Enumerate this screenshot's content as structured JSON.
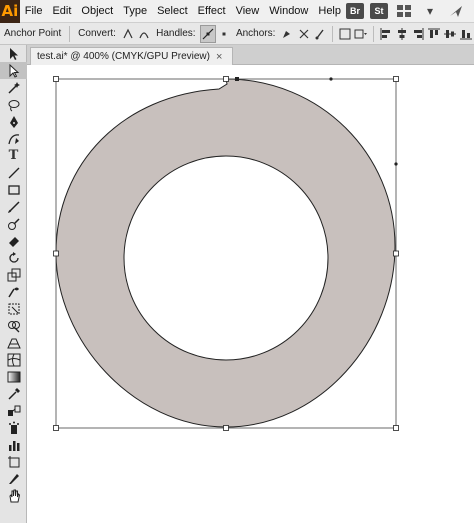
{
  "menubar": {
    "logo": "Ai",
    "items": [
      "File",
      "Edit",
      "Object",
      "Type",
      "Select",
      "Effect",
      "View",
      "Window",
      "Help"
    ],
    "right_badges": [
      "Br",
      "St"
    ]
  },
  "controlbar": {
    "anchor_point_label": "Anchor Point",
    "convert_label": "Convert:",
    "handles_label": "Handles:",
    "anchors_label": "Anchors:"
  },
  "document": {
    "tab_title": "test.ai* @ 400% (CMYK/GPU Preview)",
    "close_glyph": "×"
  },
  "artwork": {
    "ring_fill": "#c8c0bd",
    "stroke": "#222222",
    "hole_fill": "#ffffff"
  },
  "toolbar": {
    "tools": [
      "selection-tool",
      "direct-selection-tool",
      "magic-wand-tool",
      "lasso-tool",
      "pen-tool",
      "curvature-tool",
      "type-tool",
      "line-segment-tool",
      "rectangle-tool",
      "paintbrush-tool",
      "shaper-tool",
      "eraser-tool",
      "rotate-tool",
      "scale-tool",
      "warp-tool",
      "free-transform-tool",
      "shape-builder-tool",
      "perspective-grid-tool",
      "mesh-tool",
      "gradient-tool",
      "eyedropper-tool",
      "blend-tool",
      "symbol-sprayer-tool",
      "column-graph-tool",
      "artboard-tool",
      "slice-tool",
      "hand-tool"
    ]
  }
}
